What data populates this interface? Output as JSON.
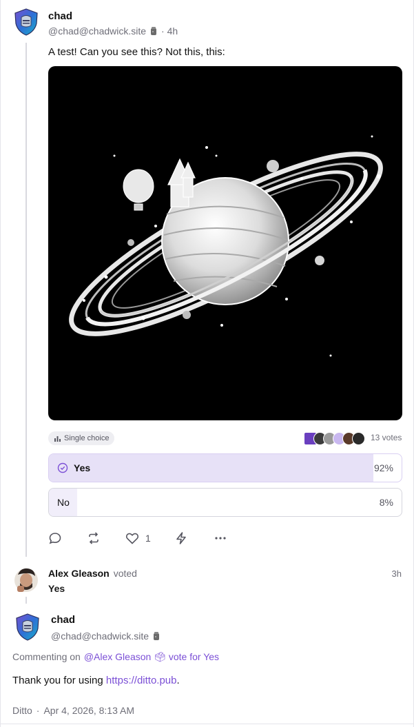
{
  "post": {
    "author_name": "chad",
    "author_handle": "@chad@chadwick.site",
    "time": "· 4h",
    "text": "A test! Can you see this? Not this, this:",
    "poll": {
      "type_label": "Single choice",
      "votes_label": "13 votes",
      "options": [
        {
          "label": "Yes",
          "percent": "92%",
          "fraction": 0.92,
          "selected": true
        },
        {
          "label": "No",
          "percent": "8%",
          "fraction": 0.08,
          "selected": false
        }
      ]
    },
    "like_count": "1"
  },
  "vote_event": {
    "author_name": "Alex Gleason",
    "verb": "voted",
    "time": "3h",
    "choice": "Yes"
  },
  "reply": {
    "author_name": "chad",
    "author_handle": "@chad@chadwick.site",
    "commenting_prefix": "Commenting on",
    "commenting_target": "@Alex Gleason 🗳 vote for Yes",
    "text_before": "Thank you for using",
    "link": "https://ditto.pub",
    "text_after": ".",
    "client": "Ditto",
    "separator": "·",
    "date": "Apr 4, 2026, 8:13 AM"
  },
  "colors": {
    "accent": "#7b4fd6",
    "poll_fill": "#e7e1f7",
    "muted": "#6e6e78"
  }
}
